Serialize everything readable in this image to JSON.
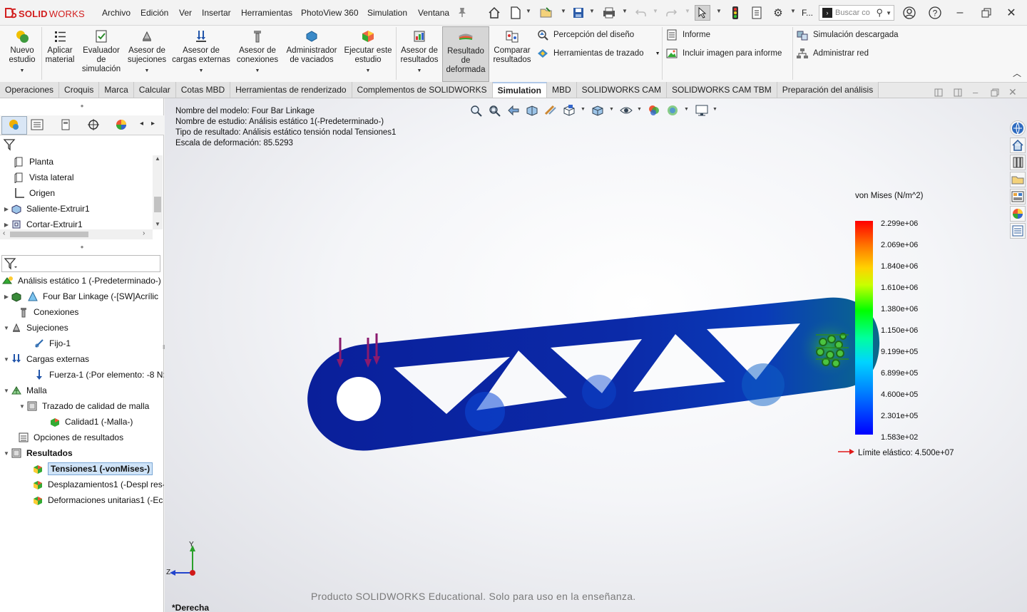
{
  "app": {
    "brand_prefix": "SOLID",
    "brand_suffix": "WORKS"
  },
  "menu": [
    "Archivo",
    "Edición",
    "Ver",
    "Insertar",
    "Herramientas",
    "PhotoView 360",
    "Simulation",
    "Ventana"
  ],
  "search": {
    "placeholder": "Buscar co",
    "short_label": "F..."
  },
  "ribbon": {
    "nuevo_estudio": [
      "Nuevo",
      "estudio"
    ],
    "aplicar_material": [
      "Aplicar",
      "material"
    ],
    "evaluador": [
      "Evaluador",
      "de",
      "simulación"
    ],
    "asesor_sujeciones": [
      "Asesor de",
      "sujeciones"
    ],
    "asesor_cargas": [
      "Asesor de",
      "cargas externas"
    ],
    "asesor_conexiones": [
      "Asesor de",
      "conexiones"
    ],
    "admin_vaciados": [
      "Administrador",
      "de vaciados"
    ],
    "ejecutar": [
      "Ejecutar este",
      "estudio"
    ],
    "asesor_resultados": [
      "Asesor de",
      "resultados"
    ],
    "resultado_deformada": [
      "Resultado",
      "de",
      "deformada"
    ],
    "comparar": [
      "Comparar",
      "resultados"
    ],
    "percepcion": "Percepción del diseño",
    "herramientas_trazado": "Herramientas de trazado",
    "informe": "Informe",
    "incluir_imagen": "Incluir imagen para informe",
    "simulacion_descargada": "Simulación descargada",
    "administrar_red": "Administrar red"
  },
  "tabs": [
    "Operaciones",
    "Croquis",
    "Marca",
    "Calcular",
    "Cotas MBD",
    "Herramientas de renderizado",
    "Complementos de SOLIDWORKS",
    "Simulation",
    "MBD",
    "SOLIDWORKS CAM",
    "SOLIDWORKS CAM TBM",
    "Preparación del análisis"
  ],
  "active_tab": "Simulation",
  "feature_tree": [
    "Planta",
    "Vista lateral",
    "Origen",
    "Saliente-Extruir1",
    "Cortar-Extruir1"
  ],
  "study_tree": [
    "Análisis estático 1 (-Predeterminado-)",
    "Four Bar Linkage (-[SW]Acrílic",
    "Conexiones",
    "Sujeciones",
    "Fijo-1",
    "Cargas externas",
    "Fuerza-1 (:Por elemento: -8 N:",
    "Malla",
    "Trazado de calidad de malla",
    "Calidad1 (-Malla-)",
    "Opciones de resultados",
    "Resultados",
    "Tensiones1 (-vonMises-)",
    "Desplazamientos1 (-Despl res-",
    "Deformaciones unitarias1 (-Ec"
  ],
  "info": [
    "Nombre del modelo: Four Bar Linkage",
    "Nombre de estudio: Análisis estático 1(-Predeterminado-)",
    "Tipo de resultado: Análisis estático tensión nodal Tensiones1",
    "Escala de deformación: 85.5293"
  ],
  "legend": {
    "title": "von Mises (N/m^2)",
    "ticks": [
      "2.299e+06",
      "2.069e+06",
      "1.840e+06",
      "1.610e+06",
      "1.380e+06",
      "1.150e+06",
      "9.199e+05",
      "6.899e+05",
      "4.600e+05",
      "2.301e+05",
      "1.583e+02"
    ],
    "yield": "Límite elástico: 4.500e+07"
  },
  "watermark": "Producto SOLIDWORKS Educational. Solo para uso en la enseñanza.",
  "view_name": "*Derecha",
  "triad": {
    "y": "Y",
    "z": "Z"
  },
  "colors": {
    "brand": "#d21f1f",
    "part_blue": "#0d2a9a",
    "load_arrow": "#8a1a6e",
    "selection": "#cfe3f7"
  }
}
